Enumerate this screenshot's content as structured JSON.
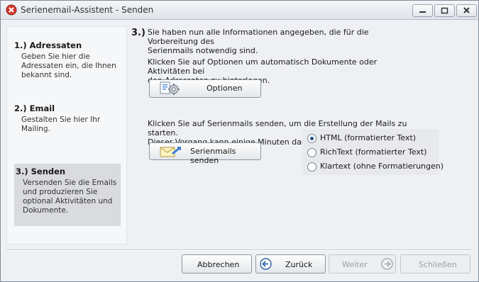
{
  "window": {
    "title": "Serienemail-Assistent - Senden"
  },
  "sidebar": {
    "steps": [
      {
        "title": "1.) Adressaten",
        "desc": [
          "Geben Sie hier die",
          "Adressaten ein, die Ihnen",
          "bekannt sind."
        ]
      },
      {
        "title": "2.) Email",
        "desc": [
          "Gestalten Sie hier Ihr",
          "Mailing."
        ]
      },
      {
        "title": "3.) Senden",
        "desc": [
          "Versenden Sie die Emails",
          "und produzieren Sie",
          "optional Aktivitäten und",
          "Dokumente."
        ]
      }
    ]
  },
  "main": {
    "step_number": "3.)",
    "intro": [
      "Sie haben nun alle Informationen angegeben, die für die Vorbereitung des",
      "Serienmails notwendig sind."
    ],
    "options_text": [
      "Klicken Sie auf Optionen um automatisch Dokumente oder Aktivitäten bei",
      "den Adressaten zu hinterlegen."
    ],
    "options_button": "Optionen",
    "send_text": [
      "Klicken Sie auf Serienmails senden, um die Erstellung der Mails zu starten.",
      "Dieser Vorgang kann einige Minuten dauern."
    ],
    "send_button": "Serienmails senden",
    "format_options": [
      {
        "label": "HTML (formatierter Text)",
        "checked": true
      },
      {
        "label": "RichText (formatierter Text)",
        "checked": false
      },
      {
        "label": "Klartext (ohne Formatierungen)",
        "checked": false
      }
    ]
  },
  "footer": {
    "cancel": "Abbrechen",
    "back": "Zurück",
    "next": "Weiter",
    "close": "Schließen"
  },
  "colors": {
    "selected_step_bg": "#d9dbde",
    "radio_dot": "#1d4d8c"
  },
  "icons": {
    "app": "red-circle-app-icon",
    "options": "gear-document-icon",
    "send": "email-send-icon",
    "back": "arrow-left-circle-icon",
    "next": "arrow-right-circle-icon"
  }
}
